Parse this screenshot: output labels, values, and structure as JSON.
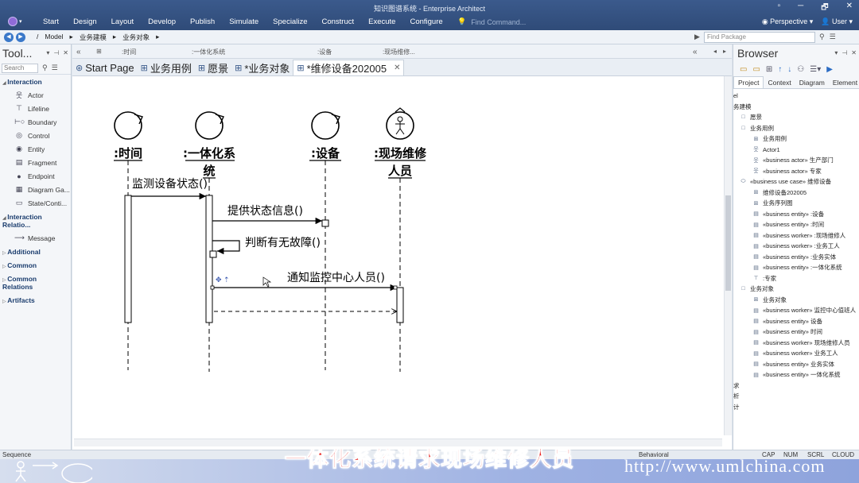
{
  "app": {
    "title": "知识图谱系统 - Enterprise Architect"
  },
  "menu": [
    "Start",
    "Design",
    "Layout",
    "Develop",
    "Publish",
    "Simulate",
    "Specialize",
    "Construct",
    "Execute",
    "Configure"
  ],
  "command": {
    "placeholder": "Find Command..."
  },
  "window_controls": [
    "▫",
    "─",
    "🗗",
    "✕"
  ],
  "perspective": {
    "label": "Perspective",
    "user": "User"
  },
  "nav": {
    "crumbs": [
      "/",
      "Model",
      "业务建模",
      "业务对象"
    ],
    "find_package": "Find Package"
  },
  "toolbox": {
    "title": "Tool...",
    "search_placeholder": "Search",
    "sections": [
      {
        "name": "Interaction",
        "items": [
          {
            "label": "Actor",
            "icon": "actor-icon",
            "glyph": "웃"
          },
          {
            "label": "Lifeline",
            "icon": "lifeline-icon",
            "glyph": "⊤"
          },
          {
            "label": "Boundary",
            "icon": "boundary-icon",
            "glyph": "⊢○"
          },
          {
            "label": "Control",
            "icon": "control-icon",
            "glyph": "◎"
          },
          {
            "label": "Entity",
            "icon": "entity-icon",
            "glyph": "◉"
          },
          {
            "label": "Fragment",
            "icon": "fragment-icon",
            "glyph": "▤"
          },
          {
            "label": "Endpoint",
            "icon": "endpoint-icon",
            "glyph": "●"
          },
          {
            "label": "Diagram Ga...",
            "icon": "diagram-gate-icon",
            "glyph": "▦"
          },
          {
            "label": "State/Conti...",
            "icon": "state-icon",
            "glyph": "▭"
          }
        ]
      },
      {
        "name": "Interaction Relatio...",
        "items": [
          {
            "label": "Message",
            "icon": "message-icon",
            "glyph": "⟶"
          }
        ]
      },
      {
        "name": "Additional",
        "items": []
      },
      {
        "name": "Common",
        "items": []
      },
      {
        "name": "Common Relations",
        "items": []
      },
      {
        "name": "Artifacts",
        "items": []
      }
    ]
  },
  "diagram_header": [
    ":时间",
    ":一体化系统",
    ":设备",
    ":现场维修..."
  ],
  "tabs": [
    {
      "label": "Start Page",
      "icon": "start-page-icon",
      "glyph": "⊛",
      "active": false
    },
    {
      "label": "业务用例",
      "icon": "usecase-diagram-icon",
      "glyph": "⊞",
      "active": false
    },
    {
      "label": "愿景",
      "icon": "vision-icon",
      "glyph": "⊞",
      "active": false
    },
    {
      "label": "*业务对象",
      "icon": "class-diagram-icon",
      "glyph": "⊞",
      "active": false
    },
    {
      "label": "*维修设备202005",
      "icon": "sequence-diagram-icon",
      "glyph": "⊞",
      "active": true
    }
  ],
  "sequence": {
    "lifelines": [
      {
        "name": ":时间",
        "kind": "control"
      },
      {
        "name": ":一体化系",
        "name2": "统",
        "kind": "control"
      },
      {
        "name": ":设备",
        "kind": "control"
      },
      {
        "name": ":现场维修",
        "name2": "人员",
        "kind": "actor-control"
      }
    ],
    "messages": [
      {
        "label": "监测设备状态()"
      },
      {
        "label": "提供状态信息()"
      },
      {
        "label": "判断有无故障()"
      },
      {
        "label": "通知监控中心人员()"
      }
    ]
  },
  "browser": {
    "title": "Browser",
    "tabs": [
      "Project",
      "Context",
      "Diagram",
      "Element"
    ],
    "tree": [
      {
        "text": "el",
        "icon": ""
      },
      {
        "text": "务建模",
        "icon": ""
      },
      {
        "text": "愿景",
        "icon": "□"
      },
      {
        "text": "业务用例",
        "icon": "□"
      },
      {
        "text": "业务用例",
        "icon": "⊞"
      },
      {
        "text": "Actor1",
        "icon": "웃"
      },
      {
        "text": "«business actor» 生产部门",
        "icon": "웃"
      },
      {
        "text": "«business actor» 专家",
        "icon": "웃"
      },
      {
        "text": "«business use case» 维修设备",
        "icon": "⬭"
      },
      {
        "text": "维修设备202005",
        "icon": "⊞"
      },
      {
        "text": "业务序列图",
        "icon": "⊞"
      },
      {
        "text": "«business entity» :设备",
        "icon": "▤"
      },
      {
        "text": "«business entity» :时间",
        "icon": "▤"
      },
      {
        "text": "«business worker» :现场维修人",
        "icon": "▤"
      },
      {
        "text": "«business worker» :业务工人",
        "icon": "▤"
      },
      {
        "text": "«business entity» :业务实体",
        "icon": "▤"
      },
      {
        "text": "«business entity» :一体化系统",
        "icon": "▤"
      },
      {
        "text": ":专家",
        "icon": "⊤"
      },
      {
        "text": "业务对象",
        "icon": "□"
      },
      {
        "text": "业务对象",
        "icon": "⊞"
      },
      {
        "text": "«business worker» 监控中心值班人",
        "icon": "▤"
      },
      {
        "text": "«business entity» 设备",
        "icon": "▤"
      },
      {
        "text": "«business entity» 时间",
        "icon": "▤"
      },
      {
        "text": "«business worker» 现场维修人员",
        "icon": "▤"
      },
      {
        "text": "«business worker» 业务工人",
        "icon": "▤"
      },
      {
        "text": "«business entity» 业务实体",
        "icon": "▤"
      },
      {
        "text": "«business entity» 一体化系统",
        "icon": "▤"
      },
      {
        "text": "求",
        "icon": ""
      },
      {
        "text": "析",
        "icon": ""
      },
      {
        "text": "计",
        "icon": ""
      }
    ]
  },
  "status": {
    "left": "Sequence",
    "mode": "Behavioral",
    "indicators": [
      "CAP",
      "NUM",
      "SCRL",
      "CLOUD"
    ]
  },
  "caption": "一体化系统请求现场维修人员",
  "watermark": "http://www.umlchina.com"
}
